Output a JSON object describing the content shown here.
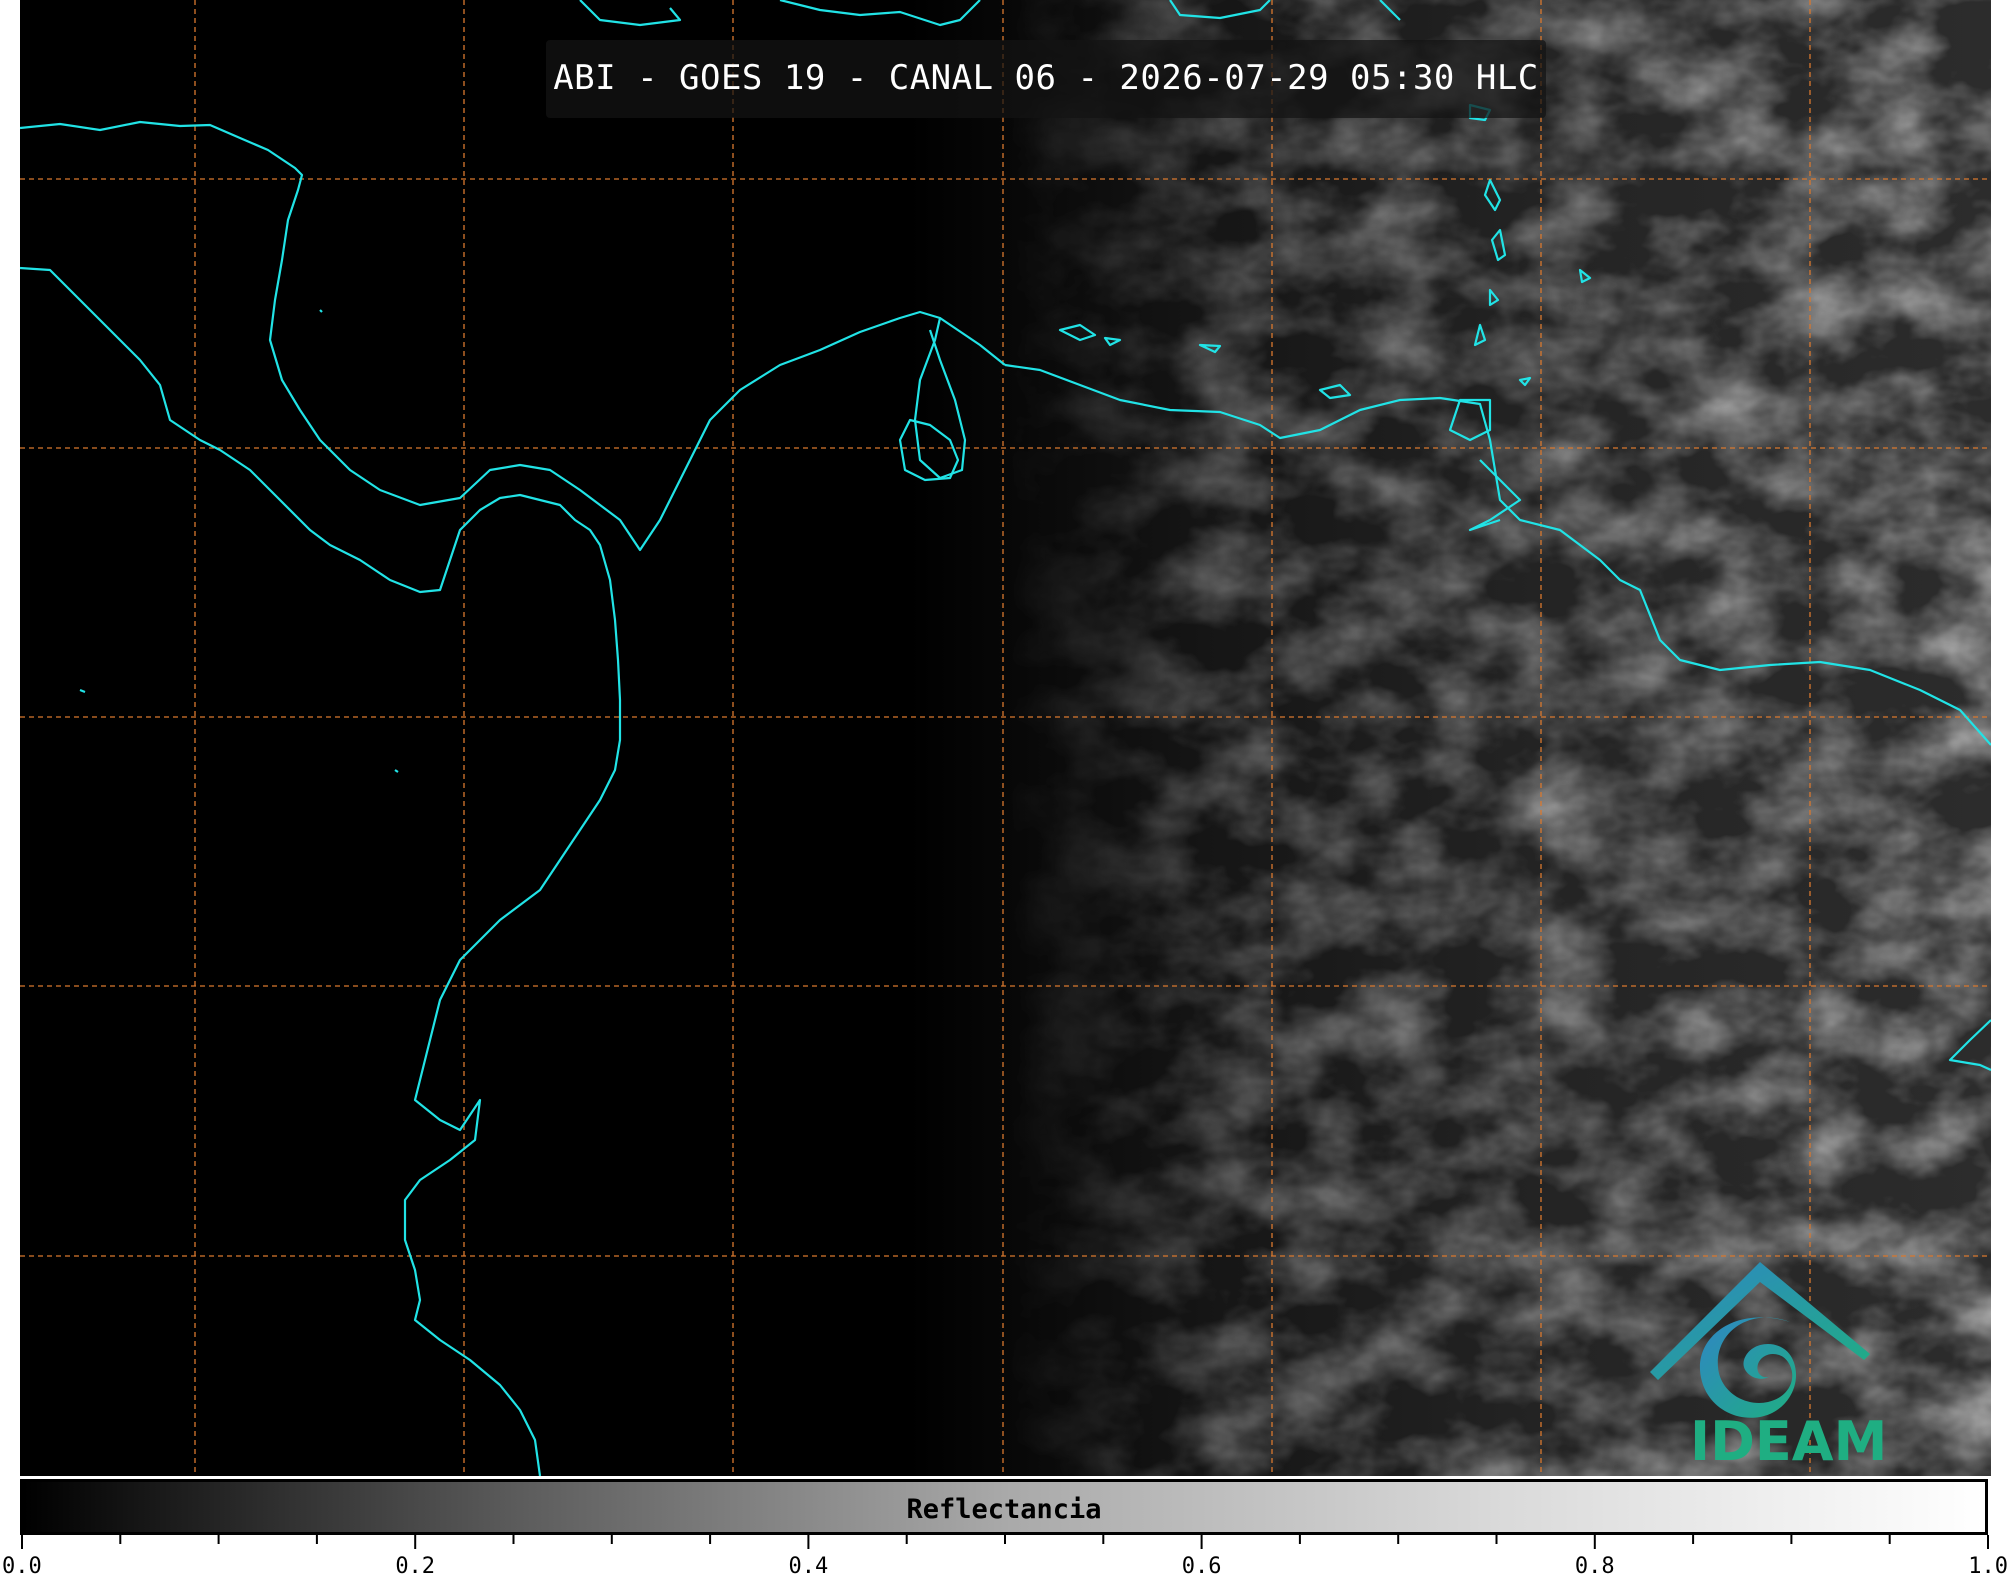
{
  "title": "ABI - GOES 19 - CANAL 06 - 2026-07-29 05:30 HLC",
  "logo": {
    "text": "IDEAM"
  },
  "colorbar": {
    "label": "Reflectancia",
    "range": [
      0.0,
      1.0
    ],
    "tick_labels": [
      "0.0",
      "0.2",
      "0.4",
      "0.6",
      "0.8",
      "1.0"
    ],
    "gradient": [
      "#000000",
      "#ffffff"
    ]
  },
  "colors": {
    "coastline": "#21e3e6",
    "gridline": "#d9782e",
    "logo_blue": "#2f86c4",
    "logo_green": "#1fae82",
    "background": "#000000"
  }
}
